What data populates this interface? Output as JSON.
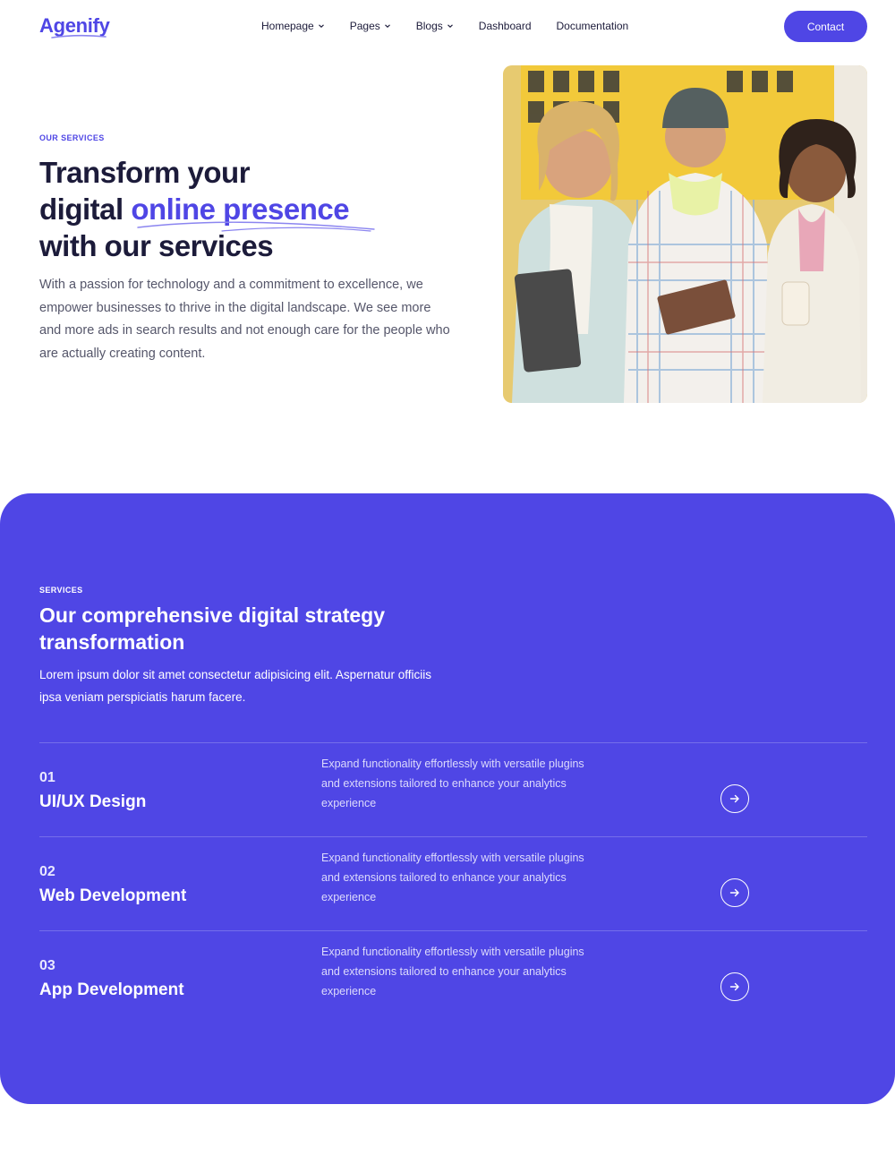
{
  "brand": {
    "name": "Agenify",
    "accent": "#4f46e5"
  },
  "nav": {
    "items": [
      {
        "label": "Homepage",
        "dropdown": true
      },
      {
        "label": "Pages",
        "dropdown": true
      },
      {
        "label": "Blogs",
        "dropdown": true
      },
      {
        "label": "Dashboard",
        "dropdown": false
      },
      {
        "label": "Documentation",
        "dropdown": false
      }
    ],
    "contact_label": "Contact"
  },
  "hero": {
    "eyebrow": "OUR SERVICES",
    "title_line1": "Transform your",
    "title_line2_plain": "digital ",
    "title_line2_highlight": "online presence",
    "title_line3": "with our services",
    "description": "With a passion for technology and a commitment to excellence, we empower businesses to thrive in the digital landscape. We see more and more ads in search results and not enough care for the people who are actually creating content."
  },
  "services": {
    "eyebrow": "SERVICES",
    "title": "Our comprehensive digital strategy transformation",
    "description": "Lorem ipsum dolor sit amet consectetur adipisicing elit. Aspernatur officiis ipsa veniam perspiciatis harum facere.",
    "items": [
      {
        "number": "01",
        "name": "UI/UX Design",
        "text": "Expand functionality effortlessly with versatile plugins and extensions tailored to enhance your analytics experience"
      },
      {
        "number": "02",
        "name": "Web Development",
        "text": "Expand functionality effortlessly with versatile plugins and extensions tailored to enhance your analytics experience"
      },
      {
        "number": "03",
        "name": "App Development",
        "text": "Expand functionality effortlessly with versatile plugins and extensions tailored to enhance your analytics experience"
      }
    ]
  }
}
